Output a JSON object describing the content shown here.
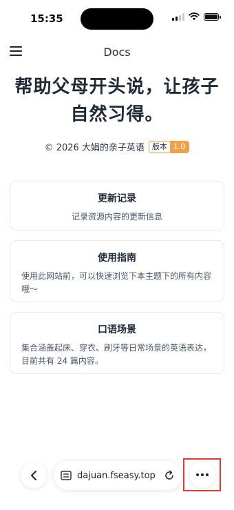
{
  "status_bar": {
    "time": "15:35",
    "battery_level": 1.0
  },
  "nav": {
    "title": "Docs",
    "menu_icon": "hamburger-menu-icon"
  },
  "hero": {
    "title": "帮助父母开头说，让孩子自然习得。",
    "copyright": "© 2026 大娟的亲子英语",
    "version_label": "版本",
    "version_number": "1.0",
    "accent_color": "#f0a24a"
  },
  "cards": [
    {
      "title": "更新记录",
      "description": "记录资源内容的更新信息"
    },
    {
      "title": "使用指南",
      "description": "使用此网站前，可以快速浏览下本主题下的所有内容哦～"
    },
    {
      "title": "口语场景",
      "description": "集合涵盖起床、穿衣、刷牙等日常场景的英语表达，目前共有 24 篇内容。"
    }
  ],
  "browser_toolbar": {
    "url": "dajuan.fseasy.top",
    "back_icon": "chevron-left-icon",
    "page_icon": "page-layout-icon",
    "reload_icon": "reload-icon",
    "more_icon": "more-dots-icon",
    "highlight_color": "#e53a2e"
  }
}
